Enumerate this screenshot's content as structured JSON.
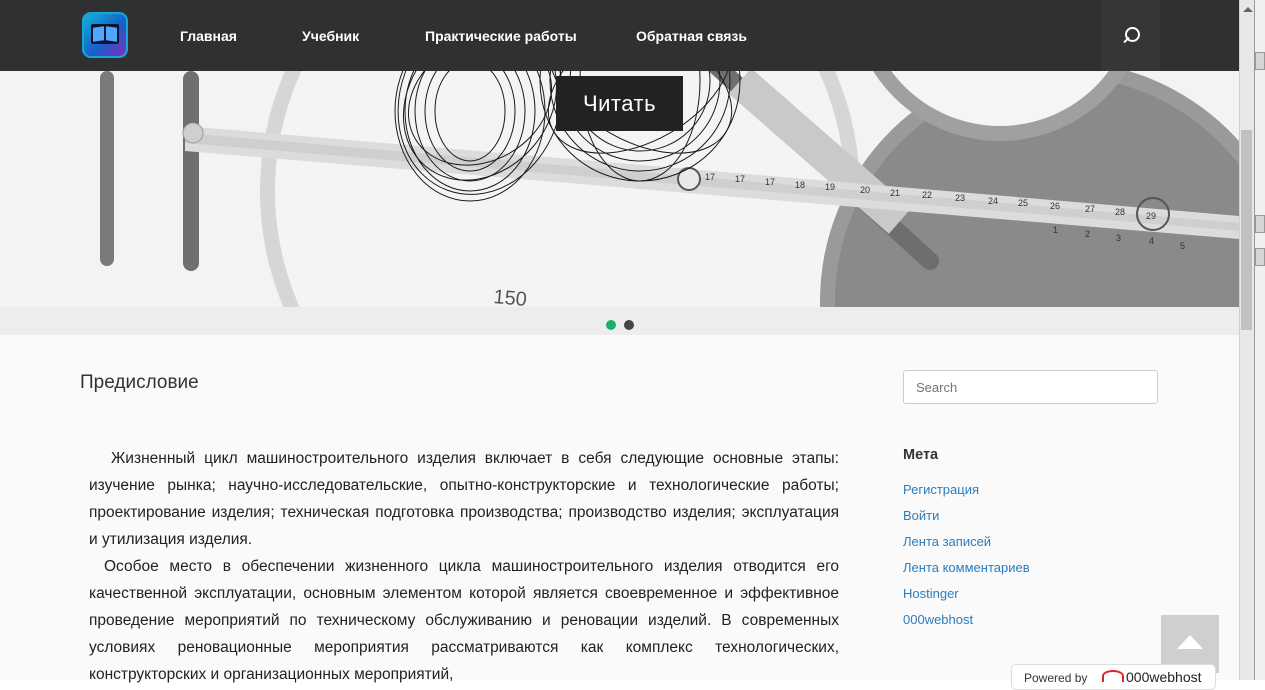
{
  "nav": {
    "items": [
      {
        "label": "Главная"
      },
      {
        "label": "Учебник"
      },
      {
        "label": "Практические работы"
      },
      {
        "label": "Обратная связь"
      }
    ],
    "search_icon": "search-icon"
  },
  "hero": {
    "button_label": "Читать",
    "ruler_numbers": [
      "17",
      "18",
      "19",
      "20",
      "21",
      "22",
      "23",
      "24",
      "25",
      "26",
      "27",
      "28",
      "29"
    ],
    "ruler_small": [
      "1",
      "2",
      "3",
      "4",
      "5"
    ],
    "dial_number": "150",
    "slides_count": 2,
    "active_slide": 1,
    "accent_color": "#1dae6b"
  },
  "post": {
    "title": "Предисловие",
    "paragraphs": [
      "Жизненный цикл машиностроительного изделия включает в себя следующие основные этапы: изучение рынка; научно-исследовательские, опытно-конструкторские и технологические работы; проектирование изделия; техническая подготовка производства; производство изделия; эксплуатация и утилизация изделия.",
      "Особое место в обеспечении жизненного цикла машиностроительного изделия отводится его качественной эксплуатации, основным элементом которой является своевременное и эффективное проведение мероприятий по техническому обслуживанию и реновации изделий. В современных условиях реновационные мероприятия рассматриваются как комплекс технологических, конструкторских и организационных мероприятий,"
    ]
  },
  "sidebar": {
    "search_placeholder": "Search",
    "meta_heading": "Мета",
    "meta_links": [
      {
        "label": "Регистрация"
      },
      {
        "label": "Войти"
      },
      {
        "label": "Лента записей"
      },
      {
        "label": "Лента комментариев"
      },
      {
        "label": "Hostinger"
      },
      {
        "label": "000webhost"
      }
    ],
    "link_color": "#2a7dc0"
  },
  "footer_badge": {
    "label": "Powered by",
    "brand": "000webhost"
  }
}
